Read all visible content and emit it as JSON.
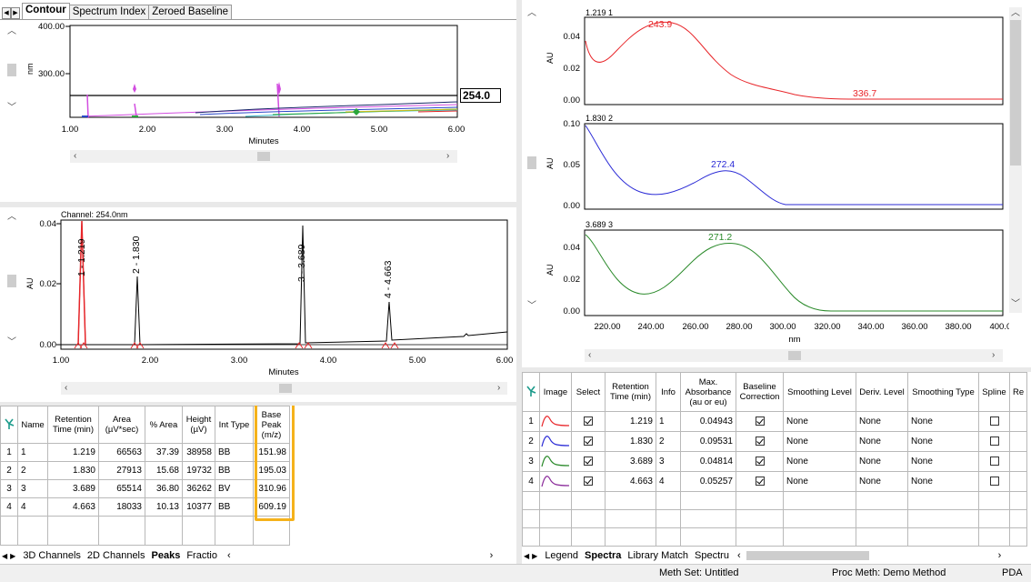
{
  "top_tabs": [
    "Contour",
    "Spectrum Index",
    "Zeroed Baseline"
  ],
  "contour": {
    "y_unit": "nm",
    "y_ticks": [
      "400.00",
      "300.00"
    ],
    "x_ticks": [
      "1.00",
      "2.00",
      "3.00",
      "4.00",
      "5.00",
      "6.00"
    ],
    "x_label": "Minutes",
    "wavelength_box": "254.0"
  },
  "chromatogram": {
    "channel": "Channel: 254.0nm",
    "y_unit": "AU",
    "y_ticks": [
      "0.04",
      "0.02",
      "0.00"
    ],
    "x_ticks": [
      "1.00",
      "2.00",
      "3.00",
      "4.00",
      "5.00",
      "6.00"
    ],
    "x_label": "Minutes",
    "peak_labels": [
      "1 - 1.219",
      "2 - 1.830",
      "3 - 3.689",
      "4 - 4.663"
    ]
  },
  "peaks_table": {
    "headers": [
      "Name",
      "Retention Time (min)",
      "Area (µV*sec)",
      "% Area",
      "Height (µV)",
      "Int Type",
      "Base Peak (m/z)"
    ],
    "rows": [
      [
        "1",
        "1",
        "1.219",
        "66563",
        "37.39",
        "38958",
        "BB",
        "151.98"
      ],
      [
        "2",
        "2",
        "1.830",
        "27913",
        "15.68",
        "19732",
        "BB",
        "195.03"
      ],
      [
        "3",
        "3",
        "3.689",
        "65514",
        "36.80",
        "36262",
        "BV",
        "310.96"
      ],
      [
        "4",
        "4",
        "4.663",
        "18033",
        "10.13",
        "10377",
        "BB",
        "609.19"
      ]
    ],
    "highlight_color": "#f5b21b"
  },
  "left_bottom_tabs": [
    "3D Channels",
    "2D Channels",
    "Peaks",
    "Fractio"
  ],
  "spectra": [
    {
      "header": "1.219 1",
      "color": "#e8262a",
      "max_label": "243.9",
      "second_label": "336.7",
      "y_ticks": [
        "0.04",
        "0.02",
        "0.00"
      ]
    },
    {
      "header": "1.830 2",
      "color": "#2b2bd6",
      "max_label": "272.4",
      "y_ticks": [
        "0.10",
        "0.05",
        "0.00"
      ]
    },
    {
      "header": "3.689 3",
      "color": "#2a8a2a",
      "max_label": "271.2",
      "y_ticks": [
        "0.04",
        "0.02",
        "0.00"
      ]
    }
  ],
  "spectra_axis": {
    "y_unit": "AU",
    "x_ticks": [
      "220.00",
      "240.00",
      "260.00",
      "280.00",
      "300.00",
      "320.00",
      "340.00",
      "360.00",
      "380.00",
      "400.00"
    ],
    "x_label": "nm"
  },
  "spectra_table": {
    "headers": [
      "Image",
      "Select",
      "Retention Time (min)",
      "Info",
      "Max. Absorbance (au or eu)",
      "Baseline Correction",
      "Smoothing Level",
      "Deriv. Level",
      "Smoothing Type",
      "Spline",
      "Re"
    ],
    "rows": [
      {
        "n": "1",
        "rt": "1.219",
        "info": "1",
        "abs": "0.04943",
        "smooth": "None",
        "deriv": "None",
        "stype": "None",
        "thumb_color": "#e8262a"
      },
      {
        "n": "2",
        "rt": "1.830",
        "info": "2",
        "abs": "0.09531",
        "smooth": "None",
        "deriv": "None",
        "stype": "None",
        "thumb_color": "#2b2bd6"
      },
      {
        "n": "3",
        "rt": "3.689",
        "info": "3",
        "abs": "0.04814",
        "smooth": "None",
        "deriv": "None",
        "stype": "None",
        "thumb_color": "#2a8a2a"
      },
      {
        "n": "4",
        "rt": "4.663",
        "info": "4",
        "abs": "0.05257",
        "smooth": "None",
        "deriv": "None",
        "stype": "None",
        "thumb_color": "#8a2a9a"
      }
    ]
  },
  "right_bottom_tabs": [
    "Legend",
    "Spectra",
    "Library Match",
    "Spectru"
  ],
  "status": {
    "meth_set": "Meth Set: Untitled",
    "proc_meth": "Proc Meth: Demo Method",
    "mode": "PDA"
  }
}
